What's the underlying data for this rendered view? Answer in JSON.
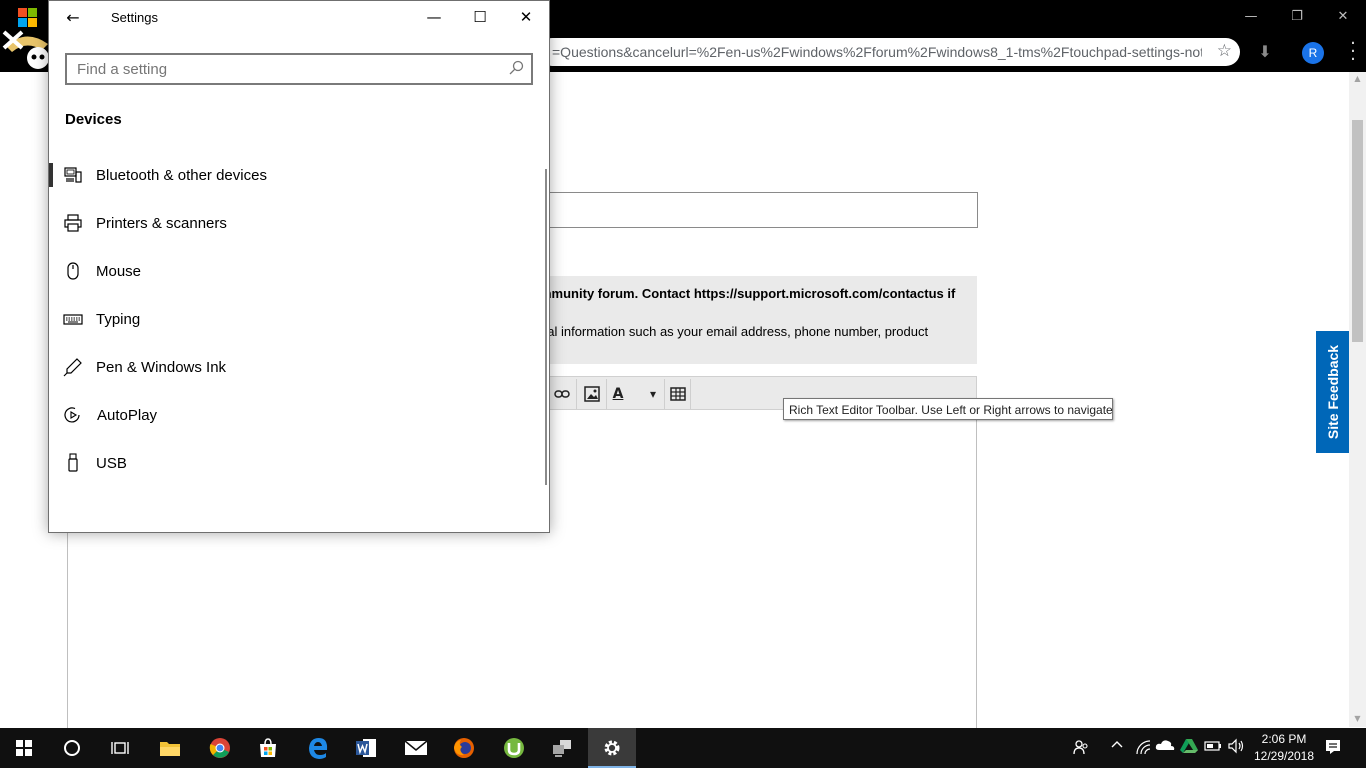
{
  "browser": {
    "url": "=Questions&cancelurl=%2Fen-us%2Fwindows%2Fforum%2Fwindows8_1-tms%2Ftouchpad-settings-not...",
    "profile_initial": "R",
    "min_glyph": "—",
    "restore_glyph": "❐",
    "close_glyph": "✕",
    "star_glyph": "☆",
    "download_glyph": "⬇",
    "menu_glyph": "⋮"
  },
  "page": {
    "notice_line1": "mmunity forum. Contact https://support.microsoft.com/contactus if",
    "notice_line2": "nal information such as your email address, phone number, product",
    "tooltip": "Rich Text Editor Toolbar. Use Left or Right arrows to navigate",
    "site_feedback": "Site Feedback",
    "toolbar_font_color_glyph": "A",
    "toolbar_dropdown_glyph": "▾"
  },
  "settings": {
    "title": "Settings",
    "back_glyph": "←",
    "minimize_glyph": "—",
    "maximize_glyph": "☐",
    "close_glyph": "✕",
    "search_placeholder": "Find a setting",
    "section": "Devices",
    "items": [
      {
        "label": "Bluetooth & other devices",
        "icon": "bluetooth-devices-icon",
        "selected": true
      },
      {
        "label": "Printers & scanners",
        "icon": "printer-icon",
        "selected": false
      },
      {
        "label": "Mouse",
        "icon": "mouse-icon",
        "selected": false
      },
      {
        "label": "Typing",
        "icon": "keyboard-icon",
        "selected": false
      },
      {
        "label": "Pen & Windows Ink",
        "icon": "pen-icon",
        "selected": false
      },
      {
        "label": "AutoPlay",
        "icon": "autoplay-icon",
        "selected": false
      },
      {
        "label": "USB",
        "icon": "usb-icon",
        "selected": false
      }
    ]
  },
  "taskbar": {
    "time": "2:06 PM",
    "date": "12/29/2018",
    "up_chevron": "^",
    "colors": {
      "accent": "#0078d7",
      "taskbar": "#101010"
    }
  }
}
